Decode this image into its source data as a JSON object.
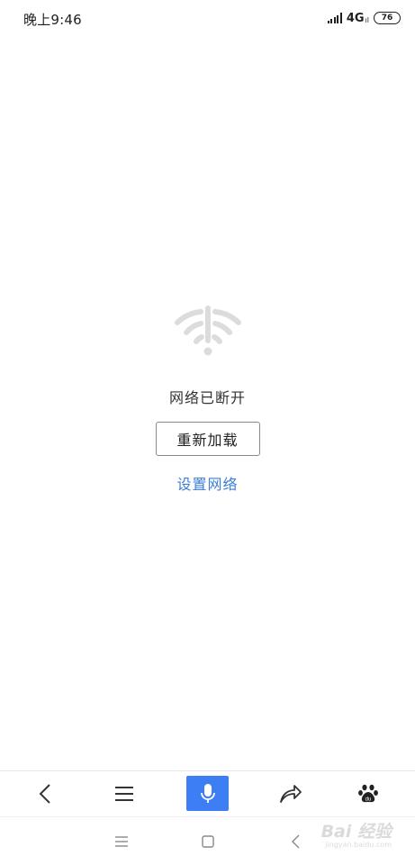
{
  "status_bar": {
    "time": "晚上9:46",
    "network": "4G",
    "network_sub": "ıl",
    "battery": "76"
  },
  "offline": {
    "icon": "wifi-off-icon",
    "message": "网络已断开",
    "reload_label": "重新加载",
    "settings_link": "设置网络"
  },
  "toolbar": {
    "items": [
      "back-icon",
      "menu-icon",
      "microphone-icon",
      "share-icon",
      "baidu-paw-icon"
    ],
    "accent_color": "#3e7ef5"
  },
  "system_nav": {
    "items": [
      "recent-apps-icon",
      "home-icon",
      "back-icon"
    ]
  },
  "watermark": {
    "brand": "Bai 经验",
    "sub": "jingyan.baidu.com"
  },
  "colors": {
    "link": "#3b7ed6",
    "icon_gray": "#dcdcdc"
  }
}
